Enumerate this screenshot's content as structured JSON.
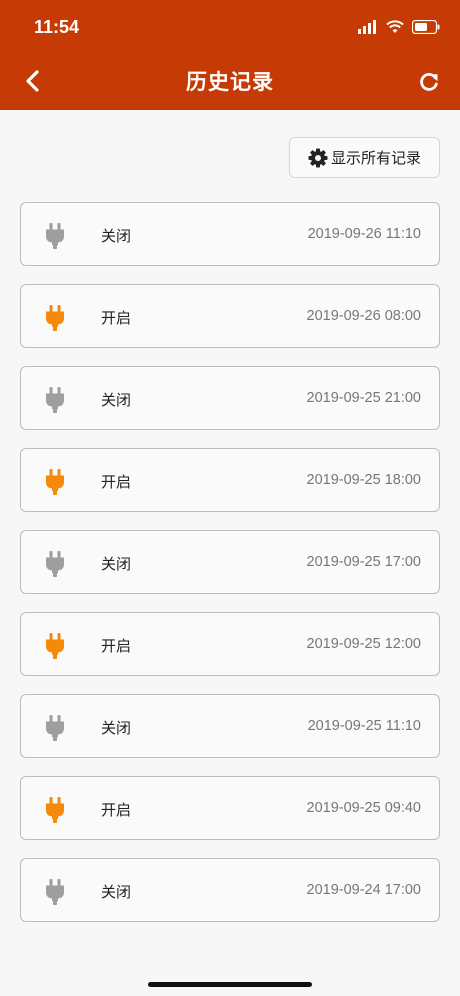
{
  "status": {
    "time": "11:54"
  },
  "nav": {
    "title": "历史记录"
  },
  "filter": {
    "label": "显示所有记录"
  },
  "colors": {
    "header": "#c53a05",
    "on": "#f5890a",
    "off": "#9e9e9e"
  },
  "records": [
    {
      "state": "关闭",
      "on": false,
      "time": "2019-09-26 11:10"
    },
    {
      "state": "开启",
      "on": true,
      "time": "2019-09-26 08:00"
    },
    {
      "state": "关闭",
      "on": false,
      "time": "2019-09-25 21:00"
    },
    {
      "state": "开启",
      "on": true,
      "time": "2019-09-25 18:00"
    },
    {
      "state": "关闭",
      "on": false,
      "time": "2019-09-25 17:00"
    },
    {
      "state": "开启",
      "on": true,
      "time": "2019-09-25 12:00"
    },
    {
      "state": "关闭",
      "on": false,
      "time": "2019-09-25 11:10"
    },
    {
      "state": "开启",
      "on": true,
      "time": "2019-09-25 09:40"
    },
    {
      "state": "关闭",
      "on": false,
      "time": "2019-09-24 17:00"
    }
  ]
}
